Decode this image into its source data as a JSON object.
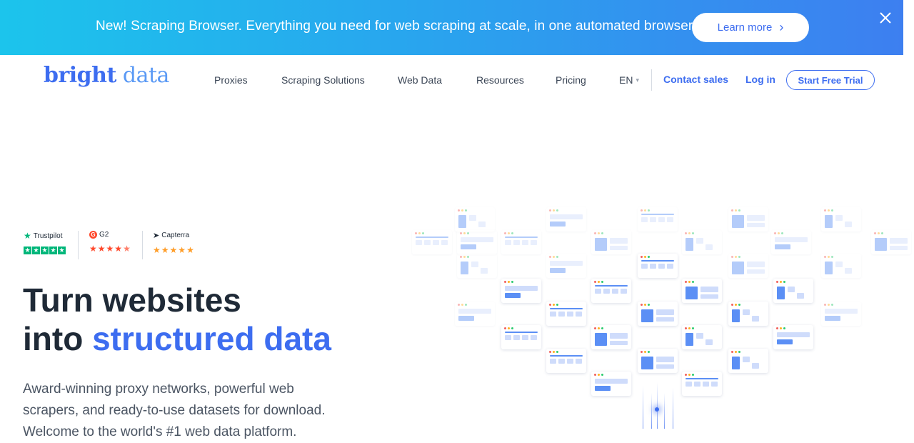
{
  "banner": {
    "text": "New! Scraping Browser. Everything you need for web scraping at scale, in one automated browser",
    "button_label": "Learn more"
  },
  "nav": {
    "logo_part1": "bright",
    "logo_part2": "data",
    "items": [
      "Proxies",
      "Scraping Solutions",
      "Web Data",
      "Resources",
      "Pricing"
    ],
    "language": "EN",
    "contact_label": "Contact sales",
    "login_label": "Log in",
    "trial_label": "Start Free Trial"
  },
  "ratings": [
    {
      "name": "Trustpilot",
      "stars": 5
    },
    {
      "name": "G2",
      "stars": 4.5
    },
    {
      "name": "Capterra",
      "stars": 5
    }
  ],
  "hero": {
    "headline_line1": "Turn websites",
    "headline_line2_prefix": "into",
    "headline_line2_accent": "structured data",
    "subtext": "Award-winning proxy networks, powerful web scrapers, and ready-to-use datasets for download. Welcome to the world's #1 web data platform."
  },
  "colors": {
    "brand_blue": "#3d6df0",
    "banner_gradient_start": "#1cc4ec",
    "banner_gradient_end": "#3d7ff0",
    "trustpilot_green": "#00b67a",
    "g2_red": "#ff492c",
    "capterra_orange": "#ff9d28"
  }
}
